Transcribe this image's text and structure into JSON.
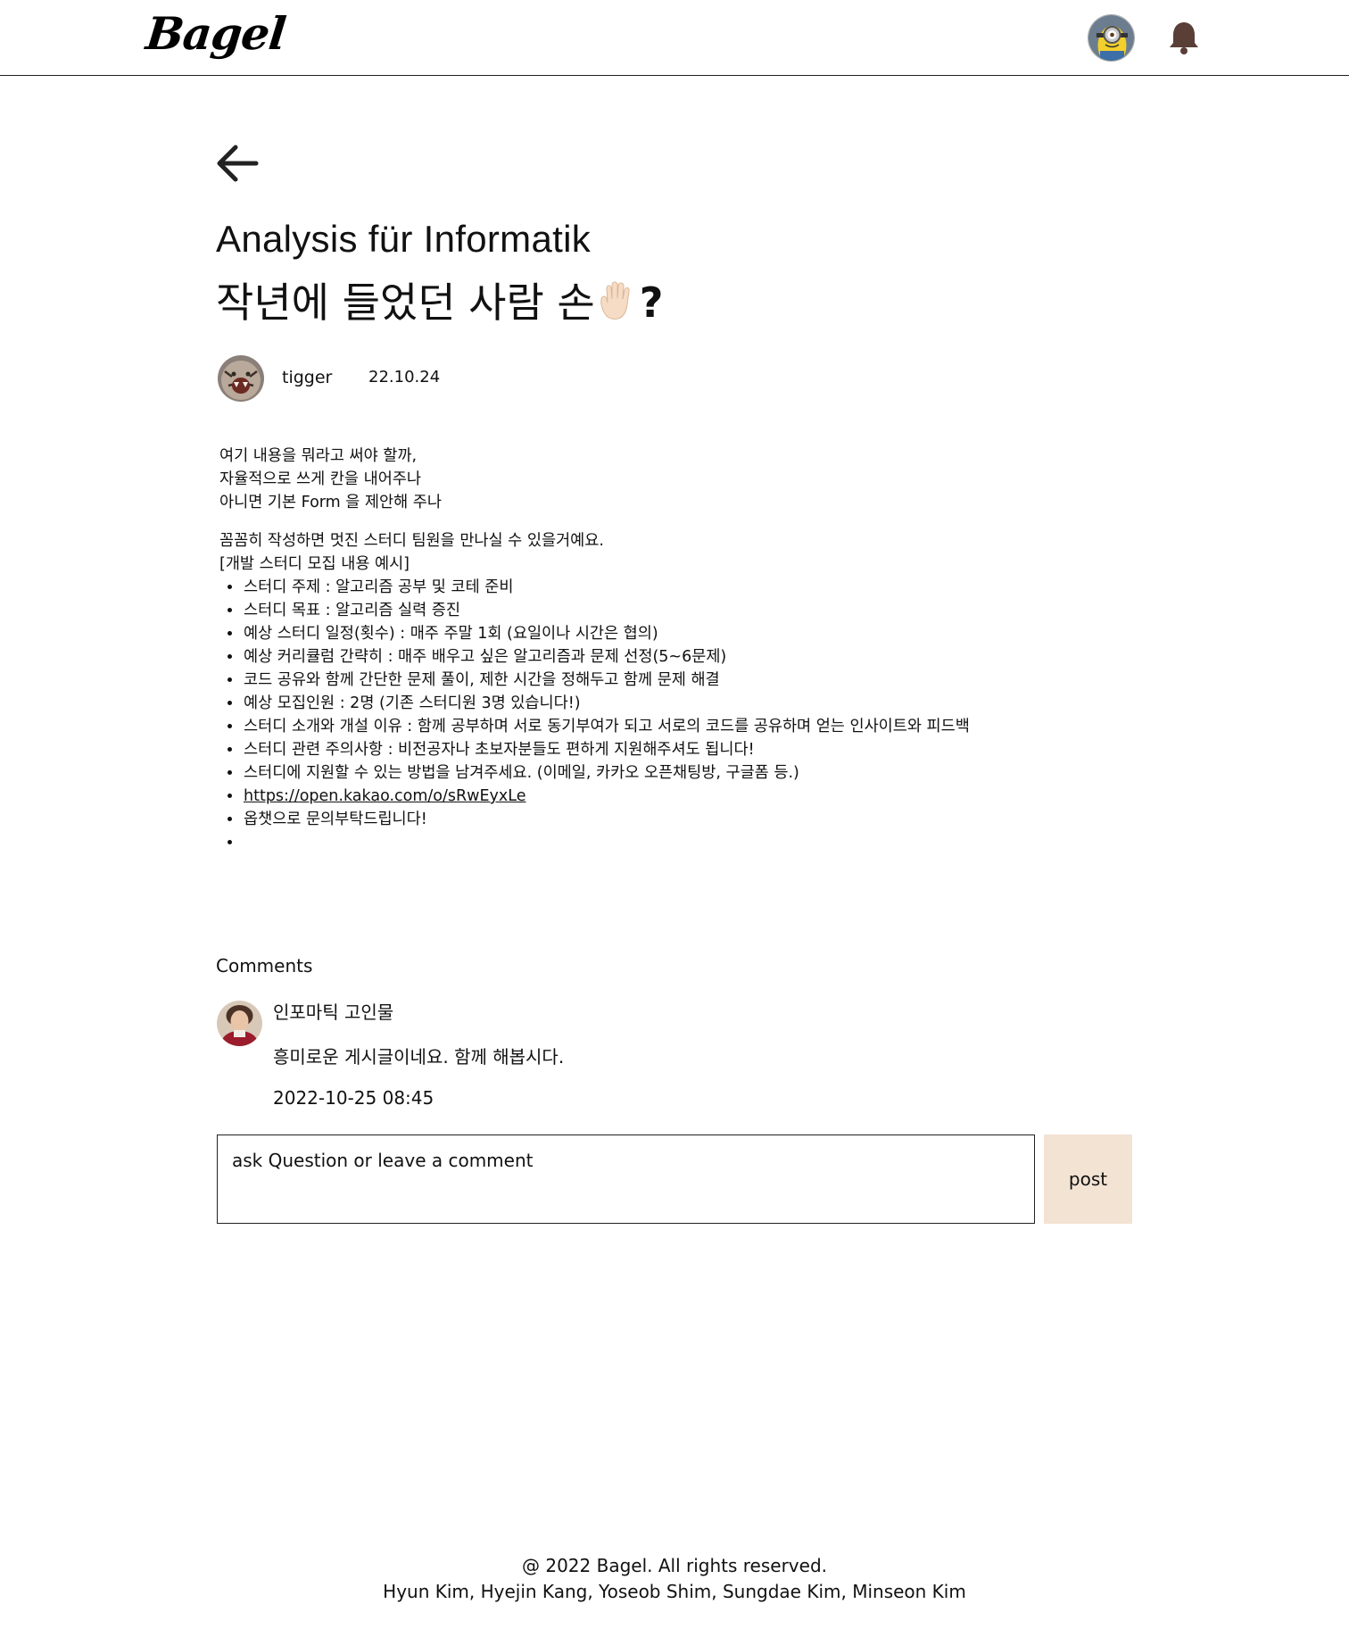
{
  "header": {
    "logo": "Bagel"
  },
  "post": {
    "title_en": "Analysis für Informatik",
    "title_ko": "작년에 들었던 사람 손",
    "title_emoji": "🖐🏻",
    "title_suffix": "?",
    "author": "tigger",
    "date": "22.10.24",
    "intro_lines": [
      "여기 내용을 뭐라고 써야 할까,",
      "자율적으로 쓰게 칸을 내어주나",
      "아니면 기본 Form 을 제안해 주나"
    ],
    "body_lines": [
      "꼼꼼히 작성하면 멋진 스터디 팀원을 만나실 수 있을거예요.",
      "[개발 스터디 모집 내용 예시]"
    ],
    "bullets": [
      "스터디 주제 : 알고리즘 공부 및 코테 준비",
      "스터디 목표 : 알고리즘 실력 증진",
      "예상 스터디 일정(횟수) : 매주 주말 1회 (요일이나 시간은 협의)",
      "예상 커리큘럼 간략히 : 매주 배우고 싶은 알고리즘과 문제 선정(5~6문제)",
      "코드 공유와 함께 간단한 문제 풀이, 제한 시간을 정해두고 함께 문제 해결",
      "예상 모집인원 : 2명 (기존 스터디원 3명 있습니다!)",
      "스터디 소개와 개설 이유 : 함께 공부하며 서로 동기부여가 되고 서로의 코드를 공유하며 얻는 인사이트와 피드백",
      "스터디 관련 주의사항 : 비전공자나 초보자분들도 편하게 지원해주셔도 됩니다!",
      "스터디에 지원할 수 있는 방법을 남겨주세요. (이메일, 카카오 오픈채팅방, 구글폼 등.)"
    ],
    "link": "https://open.kakao.com/o/sRwEyxLe",
    "closing": "옵챗으로 문의부탁드립니다!",
    "empty_bullet": ""
  },
  "comments": {
    "title": "Comments",
    "items": [
      {
        "author": "인포마틱 고인물",
        "text": "흥미로운 게시글이네요. 함께 해봅시다.",
        "time": "2022-10-25 08:45"
      }
    ],
    "input_placeholder": "ask Question or leave a comment",
    "post_label": "post"
  },
  "footer": {
    "line1": "@ 2022 Bagel. All rights reserved.",
    "line2": "Hyun Kim, Hyejin Kang, Yoseob Shim, Sungdae Kim, Minseon Kim"
  },
  "colors": {
    "post_button_bg": "#f3e3d3",
    "bell": "#5a3f37",
    "text": "#111111"
  },
  "icons": {
    "back": "arrow-left-icon",
    "bell": "bell-icon"
  }
}
